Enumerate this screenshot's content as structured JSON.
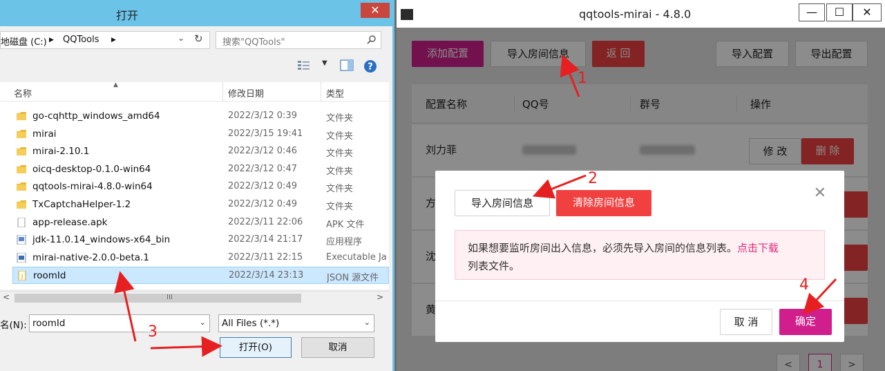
{
  "dialog": {
    "title": "打开",
    "close_glyph": "✕",
    "breadcrumb": [
      "地磁盘 (C:)",
      "QQTools"
    ],
    "search_placeholder": "搜索\"QQTools\"",
    "columns": [
      "名称",
      "修改日期",
      "类型"
    ],
    "files": [
      {
        "name": "go-cqhttp_windows_amd64",
        "date": "2022/3/12 0:39",
        "type": "文件夹",
        "kind": "folder"
      },
      {
        "name": "mirai",
        "date": "2022/3/15 19:41",
        "type": "文件夹",
        "kind": "folder"
      },
      {
        "name": "mirai-2.10.1",
        "date": "2022/3/12 0:46",
        "type": "文件夹",
        "kind": "folder"
      },
      {
        "name": "oicq-desktop-0.1.0-win64",
        "date": "2022/3/12 0:47",
        "type": "文件夹",
        "kind": "folder"
      },
      {
        "name": "qqtools-mirai-4.8.0-win64",
        "date": "2022/3/12 0:49",
        "type": "文件夹",
        "kind": "folder"
      },
      {
        "name": "TxCaptchaHelper-1.2",
        "date": "2022/3/12 0:49",
        "type": "文件夹",
        "kind": "folder"
      },
      {
        "name": "app-release.apk",
        "date": "2022/3/11 22:06",
        "type": "APK 文件",
        "kind": "file"
      },
      {
        "name": "jdk-11.0.14_windows-x64_bin",
        "date": "2022/3/14 21:17",
        "type": "应用程序",
        "kind": "app"
      },
      {
        "name": "mirai-native-2.0.0-beta.1",
        "date": "2022/3/11 22:15",
        "type": "Executable Ja",
        "kind": "jar"
      },
      {
        "name": "roomId",
        "date": "2022/3/14 23:13",
        "type": "JSON 源文件",
        "kind": "json",
        "selected": true
      }
    ],
    "filename_label": "名(N):",
    "filename_value": "roomId",
    "filetype_value": "All Files (*.*)",
    "open_button": "打开(O)",
    "cancel_button": "取消",
    "scroll_grip": "III"
  },
  "app": {
    "title": "qqtools-mirai - 4.8.0",
    "win_min": "—",
    "win_max": "☐",
    "win_close": "✕",
    "buttons": {
      "add_config": "添加配置",
      "import_room": "导入房间信息",
      "back": "返 回",
      "import_config": "导入配置",
      "export_config": "导出配置"
    },
    "table_headers": [
      "配置名称",
      "QQ号",
      "群号",
      "操作"
    ],
    "rows": [
      {
        "name": "刘力菲",
        "edit": "修 改",
        "delete": "删 除"
      },
      {
        "name": "方"
      },
      {
        "name": "沈"
      },
      {
        "name": "黄"
      }
    ],
    "pager": {
      "prev": "<",
      "current": "1",
      "next": ">"
    }
  },
  "modal": {
    "import_button": "导入房间信息",
    "clear_button": "清除房间信息",
    "close_glyph": "✕",
    "alert_text": "如果想要监听房间出入信息，必须先导入房间的信息列表。",
    "alert_link": "点击下载",
    "alert_tail": "列表文件。",
    "cancel_button": "取 消",
    "ok_button": "确定"
  },
  "annotations": [
    "1",
    "2",
    "3",
    "4"
  ],
  "colors": {
    "primary": "#d01f8c",
    "danger": "#f04040",
    "dialog_title": "#6cc3e8",
    "annotation": "#e62020"
  }
}
